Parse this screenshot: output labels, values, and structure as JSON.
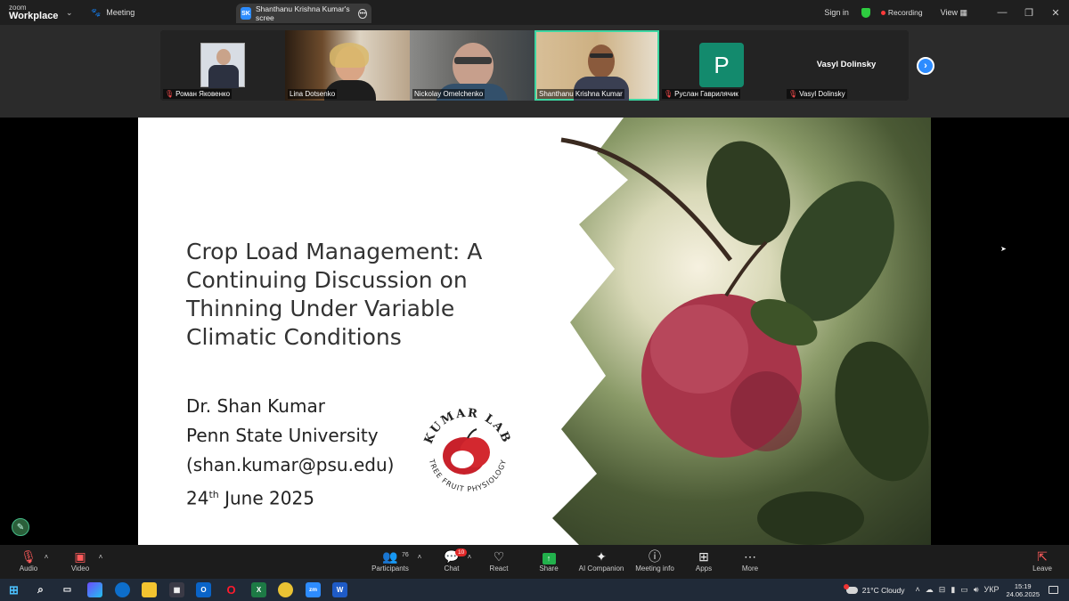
{
  "app": {
    "logo_line1": "zoom",
    "logo_line2": "Workplace",
    "meeting_label": "Meeting",
    "tab_initials": "SK",
    "tab_label": "Shanthanu Krishna Kumar's scree",
    "signin": "Sign in",
    "recording": "Recording",
    "view": "View",
    "colors": {
      "accent": "#2d8cff",
      "recording": "#ff3b3b",
      "active_tile": "#3dd6a2",
      "avatar_bg": "#138a6d"
    }
  },
  "participants": [
    {
      "name": "Роман Яковенко",
      "muted": true
    },
    {
      "name": "Lina Dotsenko",
      "muted": false
    },
    {
      "name": "Nickolay Omelchenko",
      "muted": false
    },
    {
      "name": "Shanthanu Krishna Kumar",
      "muted": false,
      "active": true
    },
    {
      "name": "Руслан Гаврилячик",
      "muted": true,
      "avatar": "P"
    },
    {
      "name": "Vasyl Dolinsky",
      "muted": true,
      "display": "Vasyl Dolinsky"
    }
  ],
  "slide": {
    "title": "Crop Load Management: A Continuing Discussion on Thinning Under Variable Climatic Conditions",
    "presenter": "Dr. Shan Kumar",
    "affiliation": "Penn State University",
    "email": "(shan.kumar@psu.edu)",
    "date_day": "24",
    "date_suffix": "th",
    "date_rest": " June 2025",
    "logo_top": "KUMAR LAB",
    "logo_bottom": "TREE FRUIT PHYSIOLOGY"
  },
  "toolbar": {
    "audio": "Audio",
    "video": "Video",
    "participants": "Participants",
    "participants_count": "76",
    "chat": "Chat",
    "chat_badge": "10",
    "react": "React",
    "share": "Share",
    "ai": "AI Companion",
    "info": "Meeting info",
    "apps": "Apps",
    "more": "More",
    "leave": "Leave"
  },
  "taskbar": {
    "weather": "21°C  Cloudy",
    "lang": "УКР",
    "time": "15:19",
    "date": "24.06.2025"
  }
}
